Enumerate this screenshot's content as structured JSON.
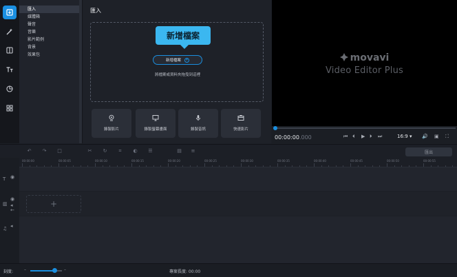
{
  "toolbar": {
    "icons": [
      "import-icon",
      "magic-wand-icon",
      "transitions-icon",
      "titles-icon",
      "stickers-icon",
      "more-tools-icon"
    ],
    "accent": "#1a8fe0"
  },
  "categories": {
    "items": [
      "匯入",
      "媒體箱",
      "聲音",
      "音樂",
      "影片範例",
      "背景",
      "效果包"
    ],
    "active_index": 0
  },
  "import_panel": {
    "title": "匯入",
    "callout": "新增檔案",
    "add_button": "新增檔案",
    "drop_text": "將檔案或資料夾拖曳到這裡",
    "capture_buttons": [
      "錄製影片",
      "錄製螢幕畫面",
      "錄製音訊",
      "快速影片"
    ]
  },
  "preview": {
    "brand": "movavi",
    "product": "Video Editor Plus",
    "timecode_main": "00:00:00",
    "timecode_frames": ".000",
    "aspect_ratio": "16:9",
    "seek_position": 0
  },
  "timeline": {
    "export_label": "匯出",
    "ruler_ticks": [
      "00:00:00",
      "00:00:05",
      "00:00:10",
      "00:00:15",
      "00:00:20",
      "00:00:25",
      "00:00:30",
      "00:00:35",
      "00:00:40",
      "00:00:45",
      "00:00:50",
      "00:00:55"
    ],
    "add_clip_symbol": "+"
  },
  "status": {
    "zoom_label": "刻度:",
    "zoom_level": 0.75,
    "duration_label": "專案長度: 00:00"
  }
}
